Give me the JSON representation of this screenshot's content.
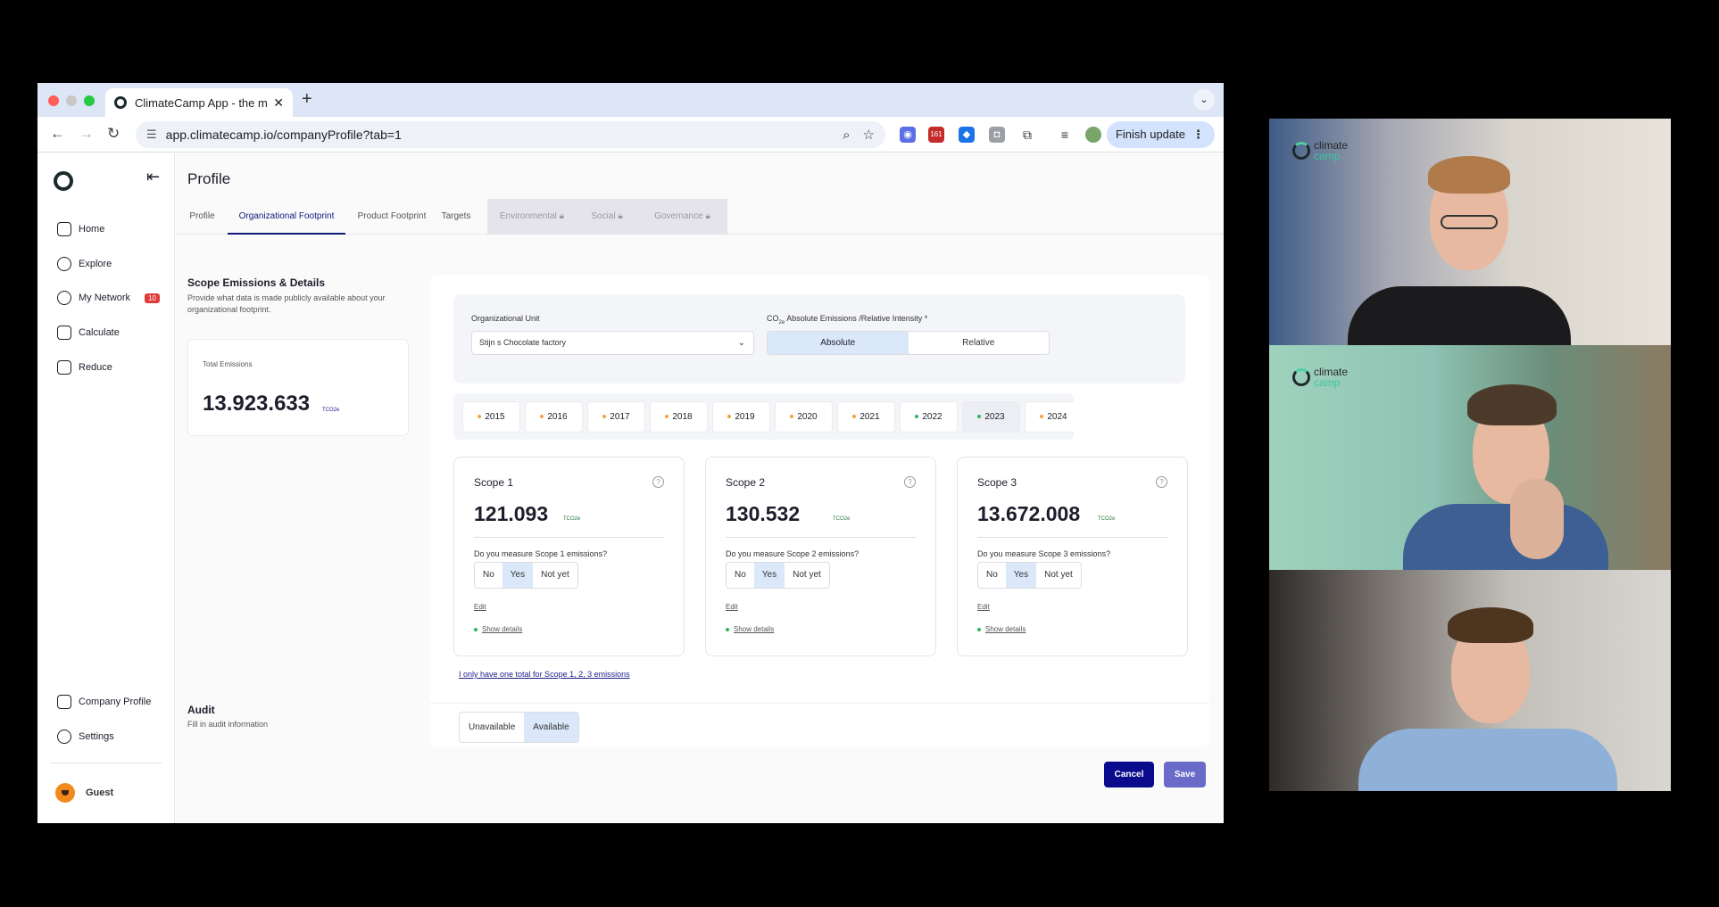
{
  "browser": {
    "tab_title": "ClimateCamp App - the most",
    "url": "app.climatecamp.io/companyProfile?tab=1",
    "extension_badge": "161",
    "finish_update_label": "Finish update",
    "icons": [
      "back-icon",
      "forward-icon",
      "reload-icon",
      "zoom-icon",
      "star-icon",
      "extensions-icon",
      "kebab-icon"
    ]
  },
  "sidebar": {
    "items": [
      {
        "label": "Home",
        "icon": "home-icon"
      },
      {
        "label": "Explore",
        "icon": "search-icon"
      },
      {
        "label": "My Network",
        "icon": "network-icon",
        "badge": "10"
      },
      {
        "label": "Calculate",
        "icon": "calculator-icon"
      },
      {
        "label": "Reduce",
        "icon": "chart-icon"
      }
    ],
    "bottom_items": [
      {
        "label": "Company Profile",
        "icon": "profile-icon"
      },
      {
        "label": "Settings",
        "icon": "gear-icon"
      }
    ],
    "user": "Guest"
  },
  "page": {
    "title": "Profile",
    "tabs": [
      "Profile",
      "Organizational Footprint",
      "Product Footprint",
      "Targets",
      "Environmental",
      "Social",
      "Governance"
    ],
    "active_tab": "Organizational Footprint"
  },
  "scope_section": {
    "title": "Scope Emissions & Details",
    "description": "Provide what data is made publicly available about your organizational footprint.",
    "total_label": "Total Emissions",
    "total_value": "13.923.633",
    "total_unit": "TCO2e"
  },
  "org_unit": {
    "label": "Organizational Unit",
    "value": "Stijn s Chocolate factory"
  },
  "emissions_mode": {
    "label_prefix": "CO",
    "label_sub": "2e",
    "label_rest": " Absolute Emissions /Relative Intensity *",
    "options": [
      "Absolute",
      "Relative"
    ],
    "selected": "Absolute"
  },
  "years": [
    {
      "year": "2015",
      "status": "orange"
    },
    {
      "year": "2016",
      "status": "orange"
    },
    {
      "year": "2017",
      "status": "orange"
    },
    {
      "year": "2018",
      "status": "orange"
    },
    {
      "year": "2019",
      "status": "orange"
    },
    {
      "year": "2020",
      "status": "orange"
    },
    {
      "year": "2021",
      "status": "orange"
    },
    {
      "year": "2022",
      "status": "green"
    },
    {
      "year": "2023",
      "status": "green",
      "selected": true
    },
    {
      "year": "2024",
      "status": "orange"
    }
  ],
  "status_colors": {
    "orange": "#f2a33a",
    "green": "#2fb463"
  },
  "scopes": [
    {
      "title": "Scope 1",
      "value": "121.093",
      "unit": "TCO2e",
      "question": "Do you measure Scope 1 emissions?",
      "options": [
        "No",
        "Yes",
        "Not yet"
      ],
      "selected": "Yes",
      "edit": "Edit",
      "details": "Show details"
    },
    {
      "title": "Scope 2",
      "value": "130.532",
      "unit": "TCO2e",
      "question": "Do you measure Scope 2 emissions?",
      "options": [
        "No",
        "Yes",
        "Not yet"
      ],
      "selected": "Yes",
      "edit": "Edit",
      "details": "Show details"
    },
    {
      "title": "Scope 3",
      "value": "13.672.008",
      "unit": "TCO2e",
      "question": "Do you measure Scope 3 emissions?",
      "options": [
        "No",
        "Yes",
        "Not yet"
      ],
      "selected": "Yes",
      "edit": "Edit",
      "details": "Show details"
    }
  ],
  "only_one_total": "I only have one total for Scope 1, 2, 3 emissions",
  "audit": {
    "title": "Audit",
    "description": "Fill in audit information",
    "options": [
      "Unavailable",
      "Available"
    ],
    "selected": "Available"
  },
  "actions": {
    "cancel": "Cancel",
    "save": "Save"
  },
  "colors": {
    "primary": "#0a0a8c",
    "save": "#6a6ac9",
    "selected_bg": "#dbe8f9"
  },
  "video_call": {
    "tiles": [
      {
        "logo_line1": "climate",
        "logo_line2": "camp"
      },
      {
        "logo_line1": "climate",
        "logo_line2": "camp"
      },
      {}
    ]
  }
}
